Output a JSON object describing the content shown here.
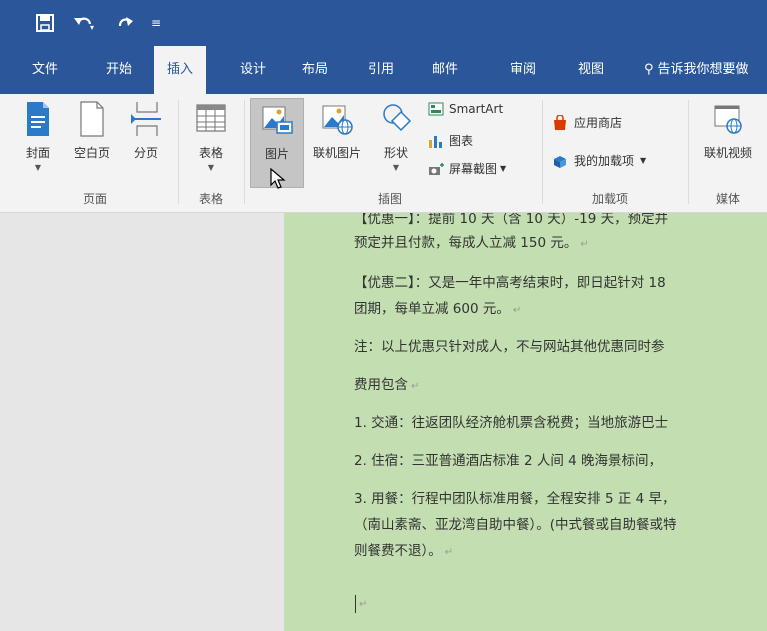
{
  "colors": {
    "accent": "#2b579a",
    "doc_bg": "#c3deb0",
    "ribbon_bg": "#f3f3f3"
  },
  "titlebar": {
    "icons": [
      "save-icon",
      "undo-icon",
      "redo-icon",
      "customize-toolbar-icon"
    ]
  },
  "tabs": [
    "文件",
    "开始",
    "插入",
    "设计",
    "布局",
    "引用",
    "邮件",
    "审阅",
    "视图"
  ],
  "active_tab": "插入",
  "tell_me": "告诉我你想要做",
  "ribbon": {
    "pages": {
      "cover": "封面",
      "blank": "空白页",
      "break": "分页",
      "group": "页面"
    },
    "tables": {
      "table": "表格",
      "group": "表格"
    },
    "illustrations": {
      "picture": "图片",
      "online_picture": "联机图片",
      "shapes": "形状",
      "smartart": "SmartArt",
      "chart": "图表",
      "screenshot": "屏幕截图",
      "group": "插图"
    },
    "addins": {
      "store": "应用商店",
      "my_addins": "我的加载项",
      "group": "加载项"
    },
    "media": {
      "online_video": "联机视频",
      "group": "媒体"
    }
  },
  "doc": {
    "line0": "【优惠一】：提前 10 天（含 10 天）-19 天，预定并",
    "line1": "预定并且付款，每成人立减 150 元。",
    "line2": "【优惠二】：又是一年中高考结束时，即日起针对 18",
    "line3": "团期，每单立减 600 元。",
    "line4": "注：以上优惠只针对成人，不与网站其他优惠同时参",
    "line5": "费用包含",
    "line6": "1. 交通：往返团队经济舱机票含税费；当地旅游巴士",
    "line7": "2. 住宿：三亚普通酒店标准 2 人间 4 晚海景标间，",
    "line8": "3. 用餐：行程中团队标准用餐，全程安排 5 正 4 早，",
    "line9": "（南山素斋、亚龙湾自助中餐）。(中式餐或自助餐或特",
    "line10": "则餐费不退）。"
  }
}
